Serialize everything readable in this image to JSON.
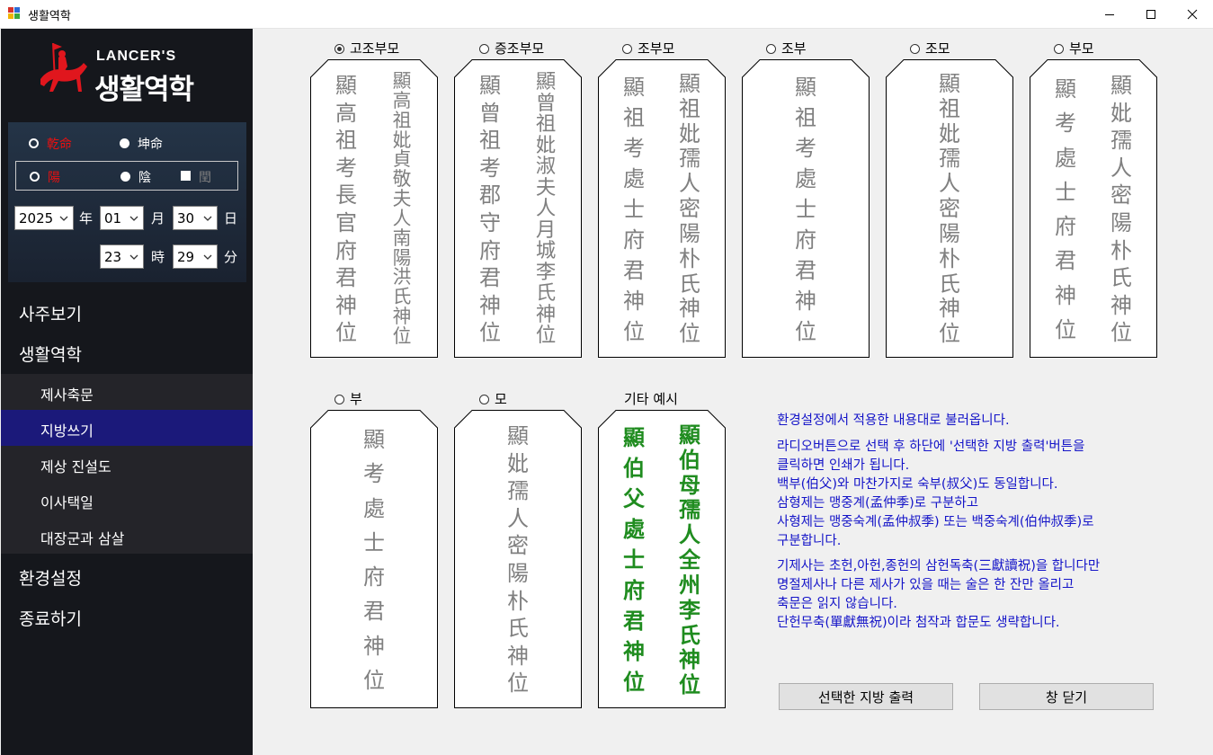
{
  "window": {
    "title": "생활역학",
    "icon": "app-icon"
  },
  "logo": {
    "brand": "LANCER'S",
    "name": "생활역학"
  },
  "birth": {
    "gan_label": "乾命",
    "gon_label": "坤命",
    "yang_label": "陽",
    "eum_label": "陰",
    "yun_label": "閏",
    "year": "2025",
    "month": "01",
    "day": "30",
    "hour": "23",
    "minute": "29",
    "year_unit": "年",
    "month_unit": "月",
    "day_unit": "日",
    "hour_unit": "時",
    "minute_unit": "分"
  },
  "menu": {
    "saju": "사주보기",
    "saenghwal": "생활역학",
    "sub": [
      "제사축문",
      "지방쓰기",
      "제상 진설도",
      "이사택일",
      "대장군과 삼살"
    ],
    "settings": "환경설정",
    "exit": "종료하기"
  },
  "options": [
    "고조부모",
    "증조부모",
    "조부모",
    "조부",
    "조모",
    "부모",
    "부",
    "모"
  ],
  "example_label": "기타 예시",
  "tablets": {
    "t1": {
      "right": "顯高祖考長官府君神位",
      "left": "顯高祖妣貞敬夫人南陽洪氏神位"
    },
    "t2": {
      "right": "顯曾祖考郡守府君神位",
      "left": "顯曾祖妣淑夫人月城李氏神位"
    },
    "t3": {
      "right": "顯祖考處士府君神位",
      "left": "顯祖妣孺人密陽朴氏神位"
    },
    "t4": {
      "single": "顯祖考處士府君神位"
    },
    "t5": {
      "single": "顯祖妣孺人密陽朴氏神位"
    },
    "t6": {
      "right": "顯考處士府君神位",
      "left": "顯妣孺人密陽朴氏神位"
    },
    "t7": {
      "single": "顯考處士府君神位"
    },
    "t8": {
      "single": "顯妣孺人密陽朴氏神位"
    },
    "t9": {
      "right": "顯伯父處士府君神位",
      "left": "顯伯母孺人全州李氏神位"
    }
  },
  "info": {
    "p1": "환경설정에서 적용한 내용대로 불러옵니다.",
    "p2a": "라디오버튼으로 선택 후 하단에 '선택한 지방 출력'버튼을",
    "p2b": "클릭하면 인쇄가 됩니다.",
    "p2c": "백부(伯父)와 마찬가지로 숙부(叔父)도 동일합니다.",
    "p2d": "삼형제는 맹중계(孟仲季)로 구분하고",
    "p2e": "사형제는 맹중숙계(孟仲叔季) 또는 백중숙계(伯仲叔季)로",
    "p2f": "구분합니다.",
    "p3a": "기제사는 초헌,아헌,종헌의 삼헌독축(三獻讀祝)을 합니다만",
    "p3b": "명절제사나 다른 제사가 있을 때는 술은 한 잔만 올리고",
    "p3c": "축문은 읽지 않습니다.",
    "p3d": "단헌무축(單獻無祝)이라 첨작과 합문도 생략합니다."
  },
  "buttons": {
    "print": "선택한 지방 출력",
    "close": "창 닫기"
  },
  "colors": {
    "sidebar": "#15171c",
    "active": "#1b197a",
    "tablet_text": "#808080",
    "example_text": "#1f8c1f",
    "info_text": "#1414c8",
    "red": "#e81010"
  }
}
